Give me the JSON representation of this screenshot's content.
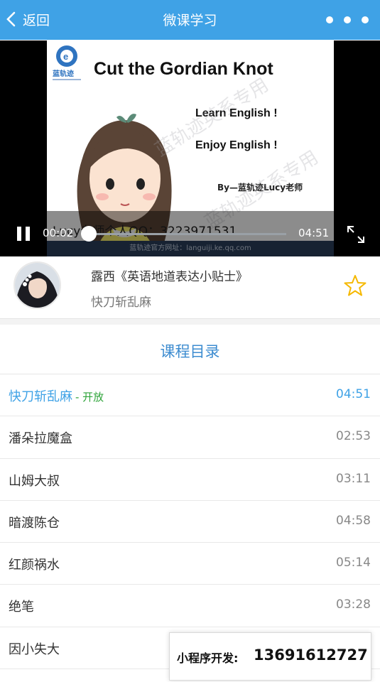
{
  "header": {
    "back_label": "返回",
    "title": "微课学习",
    "more_icon": "more-dots-icon",
    "background": "#3fa2e6"
  },
  "video": {
    "slide": {
      "logo_text": "蓝轨迹",
      "title": "Cut the Gordian Knot",
      "line1": "Learn English !",
      "line2": "Enjoy English !",
      "by": "By—蓝轨迹Lucy老师",
      "qq": "Lucy老师个人QQ：3223971531",
      "footer": "蓝轨迹官方网址：languiji.ke.qq.com",
      "watermark": "蓝轨迹英系专用"
    },
    "current_time": "00:02",
    "duration": "04:51",
    "progress": 0.007
  },
  "course": {
    "title": "露西《英语地道表达小贴士》",
    "current_lesson": "快刀斩乱麻",
    "favorite_icon": "star-outline-icon"
  },
  "catalog": {
    "heading": "课程目录",
    "items": [
      {
        "name": "快刀斩乱麻",
        "badge": "- 开放",
        "duration": "04:51",
        "active": true
      },
      {
        "name": "潘朵拉魔盒",
        "badge": "",
        "duration": "02:53",
        "active": false
      },
      {
        "name": "山姆大叔",
        "badge": "",
        "duration": "03:11",
        "active": false
      },
      {
        "name": "暗渡陈仓",
        "badge": "",
        "duration": "04:58",
        "active": false
      },
      {
        "name": "红颜祸水",
        "badge": "",
        "duration": "05:14",
        "active": false
      },
      {
        "name": "绝笔",
        "badge": "",
        "duration": "03:28",
        "active": false
      },
      {
        "name": "因小失大",
        "badge": "",
        "duration": "",
        "active": false
      }
    ]
  },
  "promo": {
    "label": "小程序开发:",
    "phone": "13691612727"
  },
  "colors": {
    "accent": "#3fa2e6",
    "open_badge": "#2fa43a",
    "star": "#f5b800"
  }
}
